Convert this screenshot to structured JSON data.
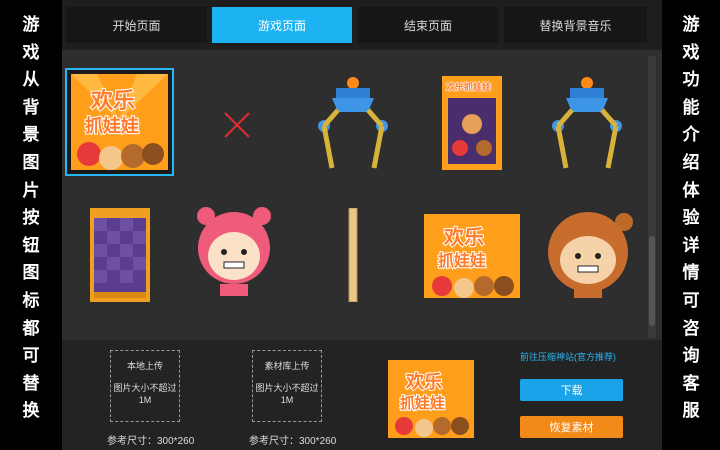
{
  "left_banner": [
    "游",
    "戏",
    "从",
    "背",
    "景",
    "图",
    "片",
    "按",
    "钮",
    "图",
    "标",
    "都",
    "可",
    "替",
    "换"
  ],
  "right_banner": [
    "游",
    "戏",
    "功",
    "能",
    "介",
    "绍",
    "体",
    "验",
    "详",
    "情",
    "可",
    "咨",
    "询",
    "客",
    "服"
  ],
  "tabs": [
    {
      "label": "开始页面",
      "active": false
    },
    {
      "label": "游戏页面",
      "active": true
    },
    {
      "label": "结束页面",
      "active": false
    },
    {
      "label": "替换背景音乐",
      "active": false
    }
  ],
  "assets": {
    "logo_line1": "欢乐",
    "logo_line2": "抓娃娃",
    "small_logo": "欢乐抓娃娃"
  },
  "bottom": {
    "upload_local": {
      "title": "本地上传",
      "hint": "图片大小不超过1M",
      "size": "参考尺寸：300*260"
    },
    "upload_library": {
      "title": "素材库上传",
      "hint": "图片大小不超过1M",
      "size": "参考尺寸：300*260"
    },
    "link": "前往压缩神站(官方推荐)",
    "download": "下载",
    "restore": "恢复素材"
  },
  "colors": {
    "accent": "#1db3f2",
    "orange": "#f28a1a",
    "bg": "#2e2e2e"
  }
}
